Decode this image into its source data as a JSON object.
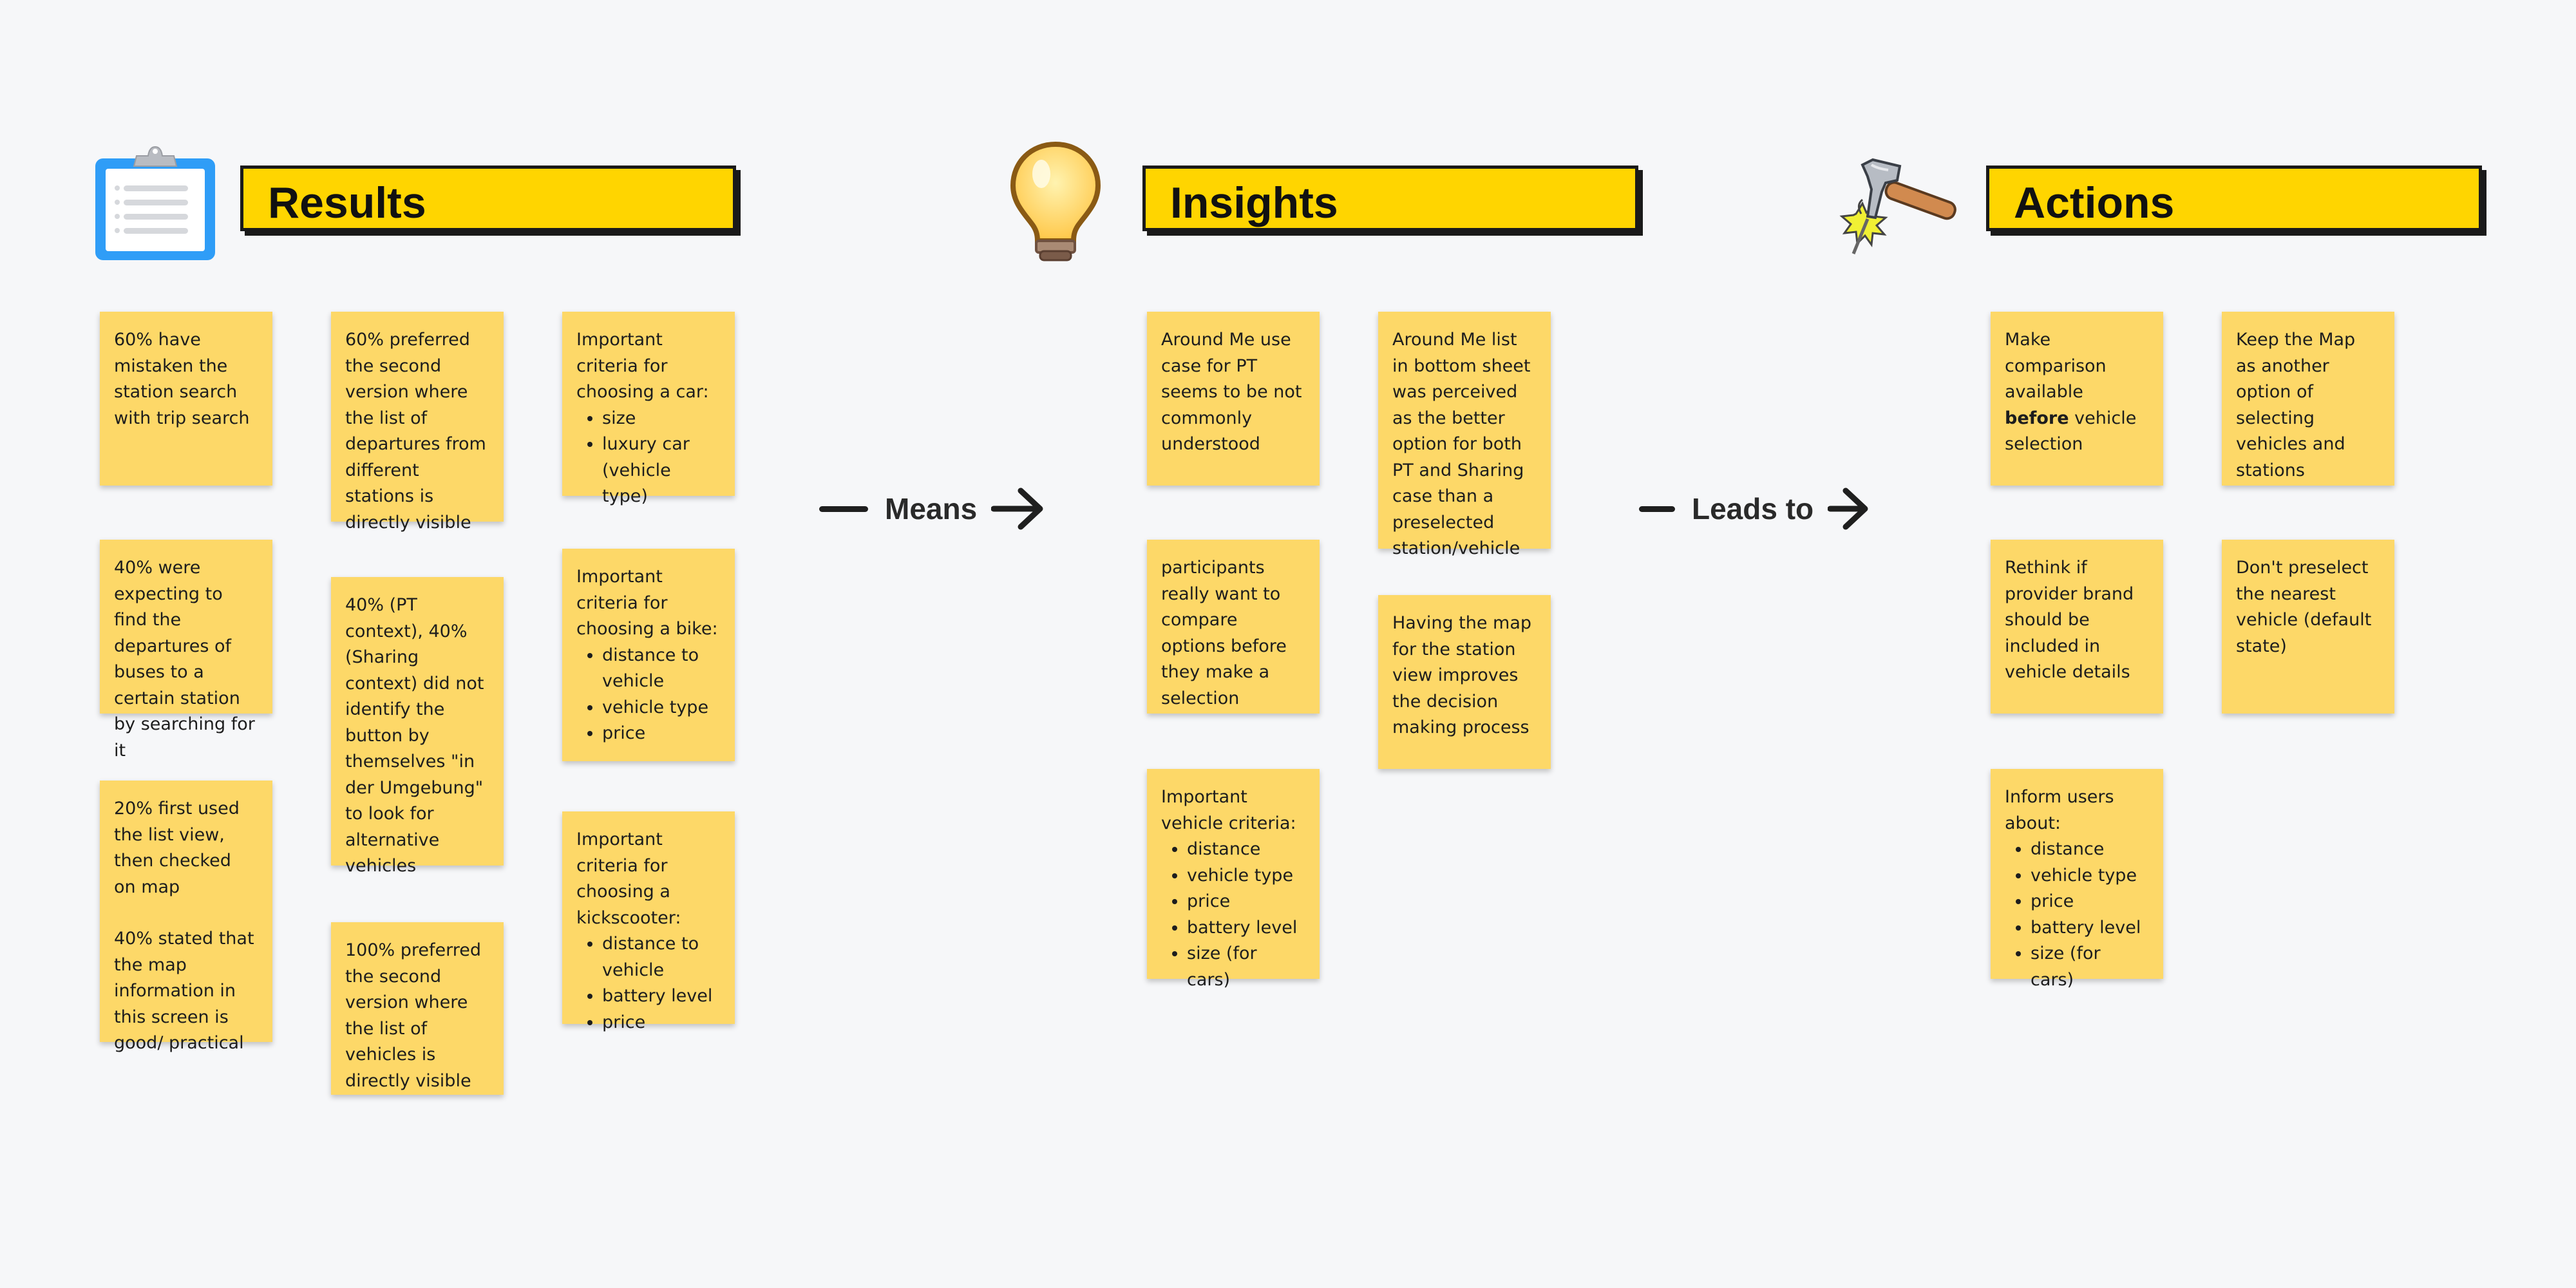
{
  "headers": {
    "results": "Results",
    "insights": "Insights",
    "actions": "Actions"
  },
  "icons": {
    "results": "clipboard-icon",
    "insights": "lightbulb-icon",
    "actions": "hammer-icon"
  },
  "connectors": {
    "means": "Means",
    "leads_to": "Leads to"
  },
  "results": {
    "n1": "60% have mistaken the station search with trip search",
    "n2": "40% were expecting to find the departures of buses to a certain station by searching for it",
    "n3_p1": "20% first used the list view, then checked on map",
    "n3_p2": "40% stated that the map information in this screen is good/ practical",
    "n4": "60% preferred the second version where the list of departures from different stations is directly visible",
    "n5": "40% (PT context), 40% (Sharing context) did not identify the button by themselves \"in der Umgebung\" to look for alternative vehicles",
    "n6": "100% preferred the second version where the list of vehicles is directly visible",
    "n7": {
      "title": "Important criteria for choosing a car:",
      "items": [
        "size",
        "luxury car (vehicle type)"
      ]
    },
    "n8": {
      "title": "Important criteria for choosing a bike:",
      "items": [
        "distance to vehicle",
        "vehicle type",
        "price"
      ]
    },
    "n9": {
      "title": "Important criteria for choosing a kickscooter:",
      "items": [
        "distance to vehicle",
        "battery level",
        "price"
      ]
    }
  },
  "insights": {
    "n1": "Around Me use case for PT seems to be not commonly understood",
    "n2": "participants really want to compare options before they make a selection",
    "n3": {
      "title": "Important vehicle criteria:",
      "items": [
        "distance",
        "vehicle type",
        "price",
        "battery level",
        "size (for cars)"
      ]
    },
    "n4": "Around Me list in bottom sheet was perceived as the better option for both PT and Sharing case than a preselected station/vehicle",
    "n5": "Having the map for the station view improves the decision making process"
  },
  "actions": {
    "n1": {
      "pre": "Make comparison available ",
      "bold": "before",
      "post": " vehicle selection"
    },
    "n2": "Rethink if provider brand should be included in vehicle details",
    "n3": {
      "title": "Inform users about:",
      "items": [
        "distance",
        "vehicle type",
        "price",
        "battery level",
        "size (for cars)"
      ]
    },
    "n4": "Keep the Map as another option of selecting vehicles and stations",
    "n5": "Don't preselect the nearest vehicle (default state)"
  },
  "colors": {
    "background": "#f6f7f9",
    "header_fill": "#ffd500",
    "header_border": "#1a1a1a",
    "note_fill": "#fdd868"
  }
}
